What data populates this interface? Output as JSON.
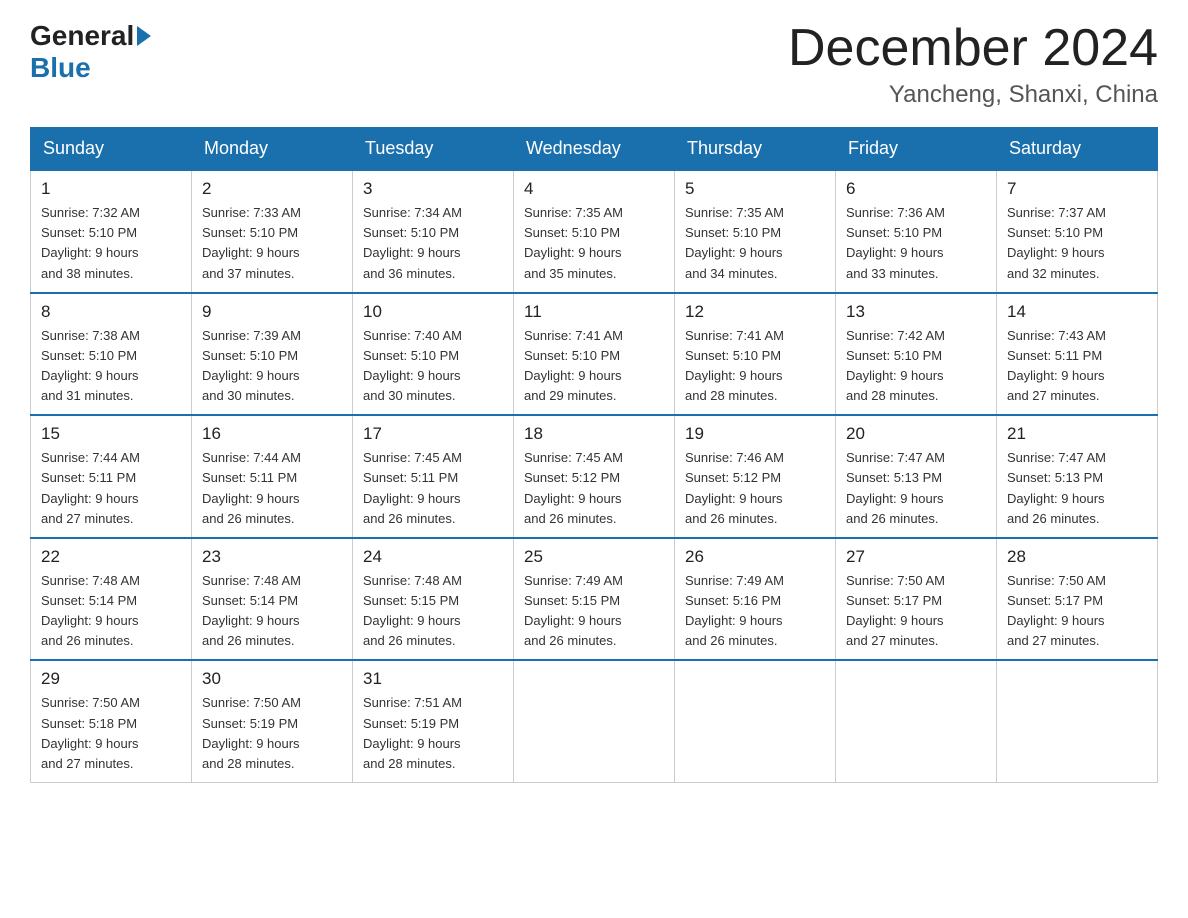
{
  "header": {
    "logo_general": "General",
    "logo_blue": "Blue",
    "month_title": "December 2024",
    "location": "Yancheng, Shanxi, China"
  },
  "days_of_week": [
    "Sunday",
    "Monday",
    "Tuesday",
    "Wednesday",
    "Thursday",
    "Friday",
    "Saturday"
  ],
  "weeks": [
    [
      {
        "day": "1",
        "sunrise": "7:32 AM",
        "sunset": "5:10 PM",
        "daylight": "9 hours and 38 minutes."
      },
      {
        "day": "2",
        "sunrise": "7:33 AM",
        "sunset": "5:10 PM",
        "daylight": "9 hours and 37 minutes."
      },
      {
        "day": "3",
        "sunrise": "7:34 AM",
        "sunset": "5:10 PM",
        "daylight": "9 hours and 36 minutes."
      },
      {
        "day": "4",
        "sunrise": "7:35 AM",
        "sunset": "5:10 PM",
        "daylight": "9 hours and 35 minutes."
      },
      {
        "day": "5",
        "sunrise": "7:35 AM",
        "sunset": "5:10 PM",
        "daylight": "9 hours and 34 minutes."
      },
      {
        "day": "6",
        "sunrise": "7:36 AM",
        "sunset": "5:10 PM",
        "daylight": "9 hours and 33 minutes."
      },
      {
        "day": "7",
        "sunrise": "7:37 AM",
        "sunset": "5:10 PM",
        "daylight": "9 hours and 32 minutes."
      }
    ],
    [
      {
        "day": "8",
        "sunrise": "7:38 AM",
        "sunset": "5:10 PM",
        "daylight": "9 hours and 31 minutes."
      },
      {
        "day": "9",
        "sunrise": "7:39 AM",
        "sunset": "5:10 PM",
        "daylight": "9 hours and 30 minutes."
      },
      {
        "day": "10",
        "sunrise": "7:40 AM",
        "sunset": "5:10 PM",
        "daylight": "9 hours and 30 minutes."
      },
      {
        "day": "11",
        "sunrise": "7:41 AM",
        "sunset": "5:10 PM",
        "daylight": "9 hours and 29 minutes."
      },
      {
        "day": "12",
        "sunrise": "7:41 AM",
        "sunset": "5:10 PM",
        "daylight": "9 hours and 28 minutes."
      },
      {
        "day": "13",
        "sunrise": "7:42 AM",
        "sunset": "5:10 PM",
        "daylight": "9 hours and 28 minutes."
      },
      {
        "day": "14",
        "sunrise": "7:43 AM",
        "sunset": "5:11 PM",
        "daylight": "9 hours and 27 minutes."
      }
    ],
    [
      {
        "day": "15",
        "sunrise": "7:44 AM",
        "sunset": "5:11 PM",
        "daylight": "9 hours and 27 minutes."
      },
      {
        "day": "16",
        "sunrise": "7:44 AM",
        "sunset": "5:11 PM",
        "daylight": "9 hours and 26 minutes."
      },
      {
        "day": "17",
        "sunrise": "7:45 AM",
        "sunset": "5:11 PM",
        "daylight": "9 hours and 26 minutes."
      },
      {
        "day": "18",
        "sunrise": "7:45 AM",
        "sunset": "5:12 PM",
        "daylight": "9 hours and 26 minutes."
      },
      {
        "day": "19",
        "sunrise": "7:46 AM",
        "sunset": "5:12 PM",
        "daylight": "9 hours and 26 minutes."
      },
      {
        "day": "20",
        "sunrise": "7:47 AM",
        "sunset": "5:13 PM",
        "daylight": "9 hours and 26 minutes."
      },
      {
        "day": "21",
        "sunrise": "7:47 AM",
        "sunset": "5:13 PM",
        "daylight": "9 hours and 26 minutes."
      }
    ],
    [
      {
        "day": "22",
        "sunrise": "7:48 AM",
        "sunset": "5:14 PM",
        "daylight": "9 hours and 26 minutes."
      },
      {
        "day": "23",
        "sunrise": "7:48 AM",
        "sunset": "5:14 PM",
        "daylight": "9 hours and 26 minutes."
      },
      {
        "day": "24",
        "sunrise": "7:48 AM",
        "sunset": "5:15 PM",
        "daylight": "9 hours and 26 minutes."
      },
      {
        "day": "25",
        "sunrise": "7:49 AM",
        "sunset": "5:15 PM",
        "daylight": "9 hours and 26 minutes."
      },
      {
        "day": "26",
        "sunrise": "7:49 AM",
        "sunset": "5:16 PM",
        "daylight": "9 hours and 26 minutes."
      },
      {
        "day": "27",
        "sunrise": "7:50 AM",
        "sunset": "5:17 PM",
        "daylight": "9 hours and 27 minutes."
      },
      {
        "day": "28",
        "sunrise": "7:50 AM",
        "sunset": "5:17 PM",
        "daylight": "9 hours and 27 minutes."
      }
    ],
    [
      {
        "day": "29",
        "sunrise": "7:50 AM",
        "sunset": "5:18 PM",
        "daylight": "9 hours and 27 minutes."
      },
      {
        "day": "30",
        "sunrise": "7:50 AM",
        "sunset": "5:19 PM",
        "daylight": "9 hours and 28 minutes."
      },
      {
        "day": "31",
        "sunrise": "7:51 AM",
        "sunset": "5:19 PM",
        "daylight": "9 hours and 28 minutes."
      },
      null,
      null,
      null,
      null
    ]
  ]
}
